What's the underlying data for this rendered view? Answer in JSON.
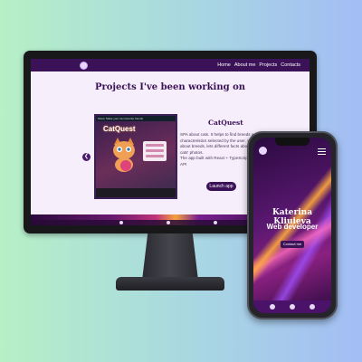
{
  "desktop": {
    "nav": {
      "links": [
        "Home",
        "About me",
        "Projects",
        "Contacts"
      ]
    },
    "section_title": "Projects I've been working on",
    "project": {
      "thumb_topbar": "Show: Make your own favorite friends",
      "thumb_title": "CatQuest",
      "thumb_footer": "",
      "name": "CatQuest",
      "description": "SPA about cats. It helps to find breeds according to the characteristics selected by the user, shows information about breeds, lets different facts about cats and shows cats' photos.\nThe app built with React + TypeScript, CSS, HTML, API",
      "button": "Launch app",
      "prev_icon": "chevron-left-icon"
    }
  },
  "phone": {
    "time": "",
    "name": "Katerina Kliuieva",
    "role": "Web developer",
    "button": "Contact me"
  },
  "colors": {
    "brand": "#3b1257",
    "accent_orange": "#f4a23d",
    "accent_pink": "#c0337a"
  }
}
